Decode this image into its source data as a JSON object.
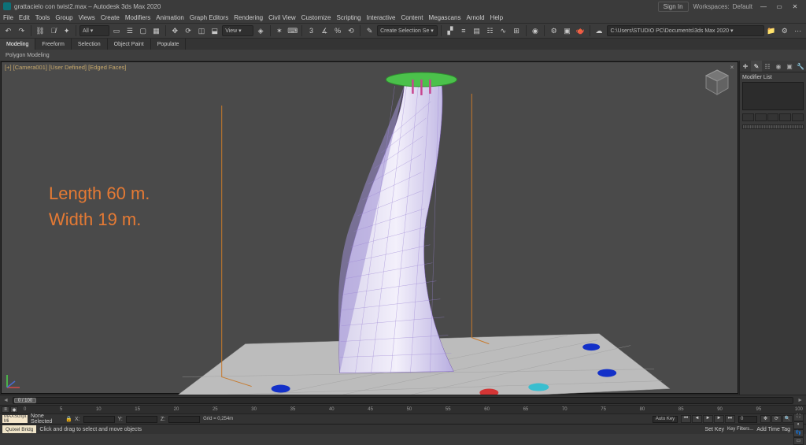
{
  "title": "grattacielo con twist2.max – Autodesk 3ds Max 2020",
  "signin": "Sign In",
  "workspace_label": "Workspaces:",
  "workspace_value": "Default",
  "menu": [
    "File",
    "Edit",
    "Tools",
    "Group",
    "Views",
    "Create",
    "Modifiers",
    "Animation",
    "Graph Editors",
    "Rendering",
    "Civil View",
    "Customize",
    "Scripting",
    "Interactive",
    "Content",
    "Megascans",
    "Arnold",
    "Help"
  ],
  "toolbar": {
    "selection_set": "Create Selection Se ▾",
    "path": "C:\\Users\\STUDIO PC\\Documents\\3ds Max 2020 ▾"
  },
  "ribbon": {
    "tabs": [
      "Modeling",
      "Freeform",
      "Selection",
      "Object Paint",
      "Populate"
    ],
    "active": 0,
    "group": "Polygon Modeling"
  },
  "viewport": {
    "label": "[+] [Camera001] [User Defined] [Edged Faces]"
  },
  "annotation": {
    "line1": "Length 60 m.",
    "line2": "Width 19 m."
  },
  "cmdpanel": {
    "modlist_label": "Modifier List"
  },
  "timeslider": {
    "thumb": "0 / 100"
  },
  "trackbar": {
    "ticks": [
      "0",
      "5",
      "10",
      "15",
      "20",
      "25",
      "30",
      "35",
      "40",
      "45",
      "50",
      "55",
      "60",
      "65",
      "70",
      "75",
      "80",
      "85",
      "90",
      "95",
      "100"
    ]
  },
  "status": {
    "maxscript": "MAXScript Mi",
    "selection": "None Selected",
    "hint": "Click and drag to select and move objects",
    "x_label": "X:",
    "y_label": "Y:",
    "z_label": "Z:",
    "grid": "Grid = 0,254m",
    "autokey": "Auto Key",
    "setkey": "Set Key",
    "keymenu": "Key Filters...",
    "framefield": "0",
    "addtag": "Add Time Tag"
  },
  "bottom2": {
    "tab": "Quixel Bridg",
    "hint": "Click and drag to select and move objects"
  }
}
